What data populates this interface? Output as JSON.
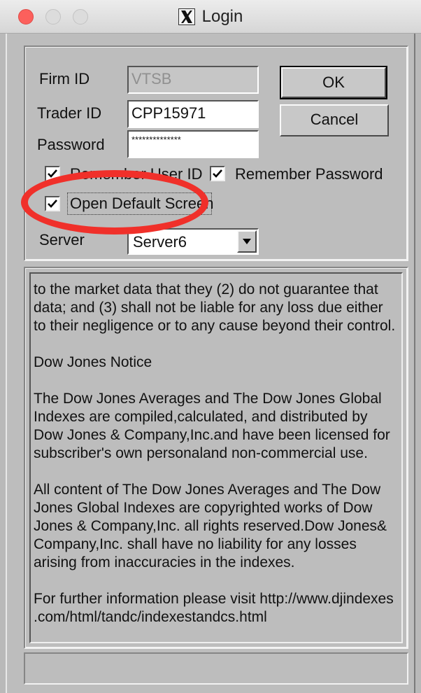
{
  "window": {
    "title": "Login",
    "app_icon": "x-window-icon"
  },
  "form": {
    "firm_id_label": "Firm ID",
    "firm_id_value": "VTSB",
    "trader_id_label": "Trader ID",
    "trader_id_value": "CPP15971",
    "password_label": "Password",
    "password_mask": "**************",
    "remember_user_id_label": "Remember User ID",
    "remember_user_id_checked": true,
    "remember_password_label": "Remember Password",
    "remember_password_checked": true,
    "open_default_screen_label": "Open Default Screen",
    "open_default_screen_checked": true,
    "server_label": "Server",
    "server_value": "Server6"
  },
  "buttons": {
    "ok_label": "OK",
    "cancel_label": "Cancel"
  },
  "notice": {
    "paragraphs": [
      "to the market data that they (2) do not guarantee that\ndata; and (3) shall not be liable for any loss due either\nto their negligence or to any cause beyond their control.",
      "Dow Jones Notice",
      "The Dow Jones Averages and The Dow Jones Global\nIndexes are compiled,calculated, and distributed by\nDow Jones & Company,Inc.and have been licensed for\nsubscriber's own personaland non-commercial use.",
      "All content of The Dow Jones Averages and The Dow\nJones Global Indexes are copyrighted works of Dow\nJones & Company,Inc. all rights reserved.Dow Jones&\nCompany,Inc. shall have no liability for any losses\narising from inaccuracies in the indexes.",
      "For further information please visit http://www.djindexes\n.com/html/tandc/indexestandcs.html"
    ]
  },
  "status_bar": {
    "text": ""
  },
  "colors": {
    "annotation": "#f0302a",
    "window_bg": "#bdbdbd",
    "close_button": "#fc605c"
  }
}
